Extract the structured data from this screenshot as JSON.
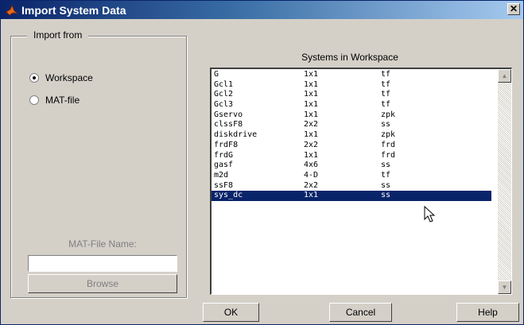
{
  "window": {
    "title": "Import System Data",
    "close_glyph": "✕"
  },
  "import_from": {
    "legend": "Import from",
    "options": [
      {
        "label": "Workspace",
        "selected": true
      },
      {
        "label": "MAT-file",
        "selected": false
      }
    ],
    "matfile_label": "MAT-File Name:",
    "matfile_value": "",
    "browse_label": "Browse"
  },
  "systems": {
    "heading": "Systems in Workspace",
    "rows": [
      {
        "name": "G",
        "size": "1x1",
        "type": "tf"
      },
      {
        "name": "Gcl1",
        "size": "1x1",
        "type": "tf"
      },
      {
        "name": "Gcl2",
        "size": "1x1",
        "type": "tf"
      },
      {
        "name": "Gcl3",
        "size": "1x1",
        "type": "tf"
      },
      {
        "name": "Gservo",
        "size": "1x1",
        "type": "zpk"
      },
      {
        "name": "clssF8",
        "size": "2x2",
        "type": "ss"
      },
      {
        "name": "diskdrive",
        "size": "1x1",
        "type": "zpk"
      },
      {
        "name": "frdF8",
        "size": "2x2",
        "type": "frd"
      },
      {
        "name": "frdG",
        "size": "1x1",
        "type": "frd"
      },
      {
        "name": "gasf",
        "size": "4x6",
        "type": "ss"
      },
      {
        "name": "m2d",
        "size": "4-D",
        "type": "tf"
      },
      {
        "name": "ssF8",
        "size": "2x2",
        "type": "ss"
      },
      {
        "name": "sys_dc",
        "size": "1x1",
        "type": "ss",
        "selected": true
      }
    ],
    "scroll_up_glyph": "▲",
    "scroll_down_glyph": "▼"
  },
  "buttons": {
    "ok": "OK",
    "cancel": "Cancel",
    "help": "Help"
  }
}
